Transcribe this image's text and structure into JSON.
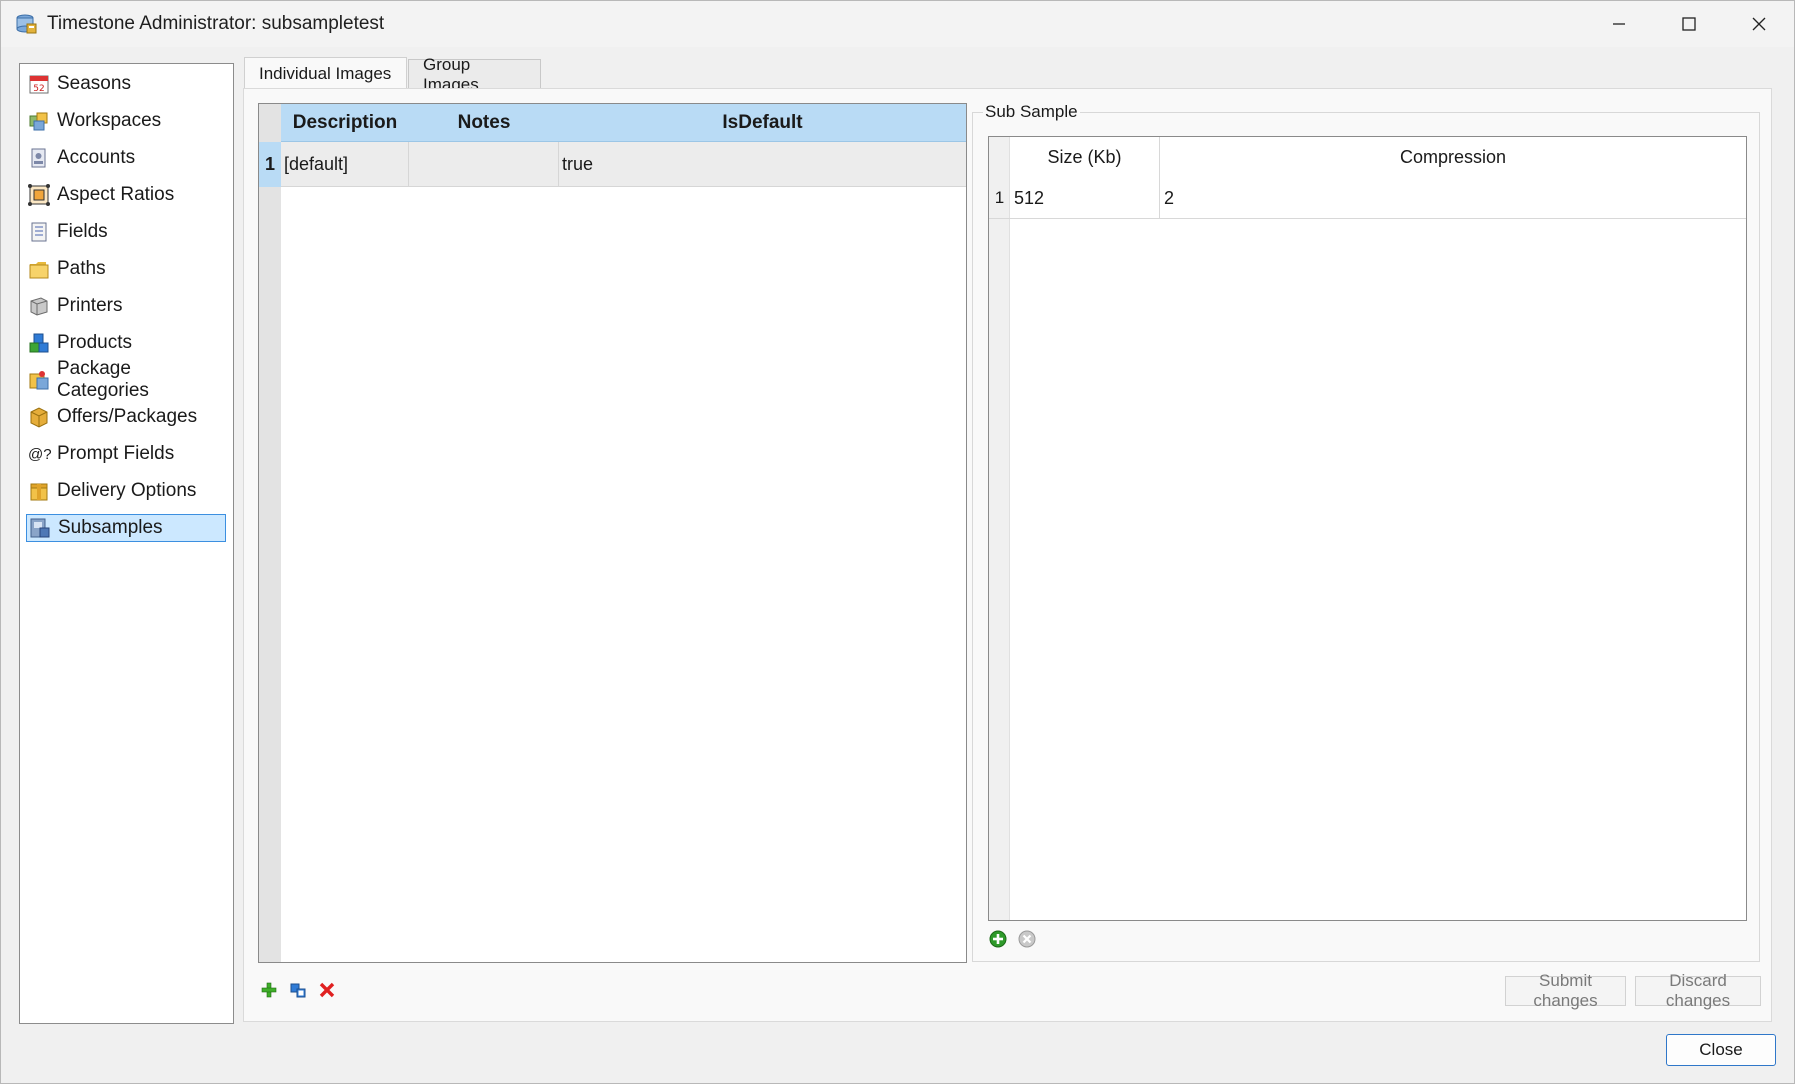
{
  "window": {
    "title": "Timestone Administrator: subsampletest"
  },
  "sidebar": {
    "items": [
      {
        "label": "Seasons",
        "icon": "calendar-icon"
      },
      {
        "label": "Workspaces",
        "icon": "workspaces-icon"
      },
      {
        "label": "Accounts",
        "icon": "accounts-icon"
      },
      {
        "label": "Aspect Ratios",
        "icon": "aspect-ratio-icon"
      },
      {
        "label": "Fields",
        "icon": "fields-icon"
      },
      {
        "label": "Paths",
        "icon": "folder-icon"
      },
      {
        "label": "Printers",
        "icon": "printer-icon"
      },
      {
        "label": "Products",
        "icon": "products-icon"
      },
      {
        "label": "Package Categories",
        "icon": "package-categories-icon"
      },
      {
        "label": "Offers/Packages",
        "icon": "package-icon"
      },
      {
        "label": "Prompt Fields",
        "icon": "prompt-fields-icon"
      },
      {
        "label": "Delivery Options",
        "icon": "delivery-icon"
      },
      {
        "label": "Subsamples",
        "icon": "subsamples-icon",
        "selected": true
      }
    ],
    "prompt_glyph": "@?"
  },
  "tabs": [
    {
      "label": "Individual Images",
      "active": true
    },
    {
      "label": "Group Images",
      "active": false
    }
  ],
  "images_grid": {
    "columns": [
      "Description",
      "Notes",
      "IsDefault"
    ],
    "rows": [
      {
        "num": "1",
        "description": "[default]",
        "notes": "",
        "isdefault": "true"
      }
    ]
  },
  "sub_sample": {
    "legend": "Sub Sample",
    "columns": [
      "Size (Kb)",
      "Compression"
    ],
    "rows": [
      {
        "num": "1",
        "size": "512",
        "compression": "2"
      }
    ]
  },
  "buttons": {
    "submit": "Submit changes",
    "discard": "Discard changes",
    "close": "Close"
  },
  "colors": {
    "header_blue": "#b9dbf5",
    "selection_blue": "#cce8ff",
    "selection_border": "#3c8fe0",
    "close_border": "#2f77c9"
  }
}
